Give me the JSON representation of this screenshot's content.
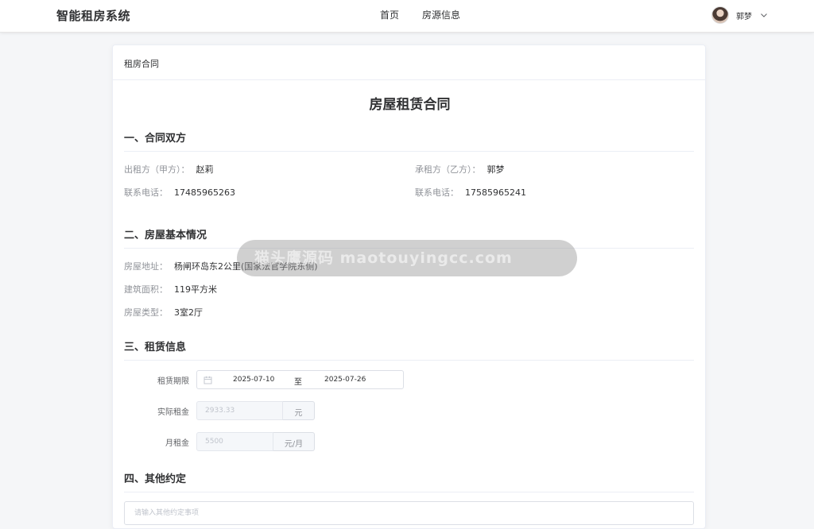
{
  "brand": "智能租房系统",
  "nav": {
    "home": "首页",
    "listings": "房源信息"
  },
  "user": {
    "name": "郭梦"
  },
  "card_header": "租房合同",
  "contract_title": "房屋租赁合同",
  "section1": {
    "title": "一、合同双方",
    "lessor_label": "出租方（甲方）：",
    "lessor_name": "赵莉",
    "lessee_label": "承租方（乙方）：",
    "lessee_name": "郭梦",
    "lessor_phone_label": "联系电话：",
    "lessor_phone": "17485965263",
    "lessee_phone_label": "联系电话：",
    "lessee_phone": "17585965241"
  },
  "section2": {
    "title": "二、房屋基本情况",
    "address_label": "房屋地址：",
    "address": "杨闸环岛东2公里(国家法官学院东侧)",
    "area_label": "建筑面积：",
    "area": "119平方米",
    "type_label": "房屋类型：",
    "type": "3室2厅"
  },
  "section3": {
    "title": "三、租赁信息",
    "period_label": "租赁期限",
    "start_date": "2025-07-10",
    "range_sep": "至",
    "end_date": "2025-07-26",
    "actual_rent_label": "实际租金",
    "actual_rent": "2933.33",
    "actual_rent_unit": "元",
    "monthly_rent_label": "月租金",
    "monthly_rent": "5500",
    "monthly_rent_unit": "元/月"
  },
  "section4": {
    "title": "四、其他约定",
    "placeholder": "请输入其他约定事项"
  },
  "watermark": "猫头鹰源码 maotouyingcc.com"
}
